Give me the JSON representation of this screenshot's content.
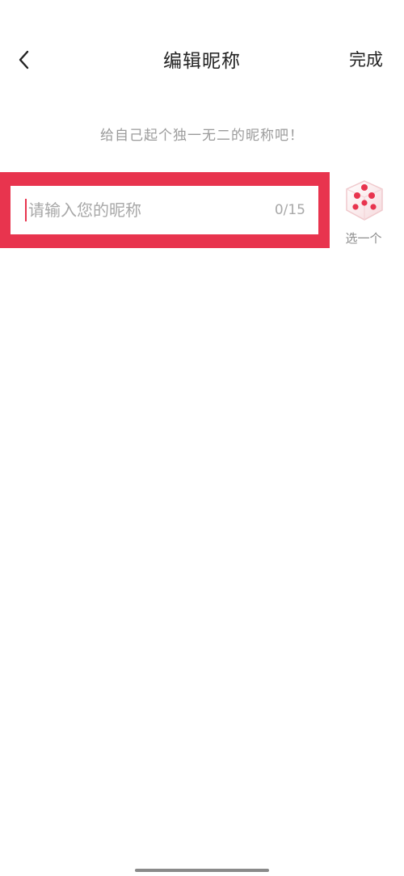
{
  "header": {
    "title": "编辑昵称",
    "done_label": "完成",
    "back_icon": "chevron-left-icon"
  },
  "subtitle": "给自己起个独一无二的昵称吧！",
  "nickname_input": {
    "value": "",
    "placeholder": "请输入您的昵称",
    "counter": "0/15",
    "highlight_color": "#e8344e"
  },
  "random_pick": {
    "icon": "dice-icon",
    "label": "选一个",
    "dot_color": "#e8344e"
  }
}
